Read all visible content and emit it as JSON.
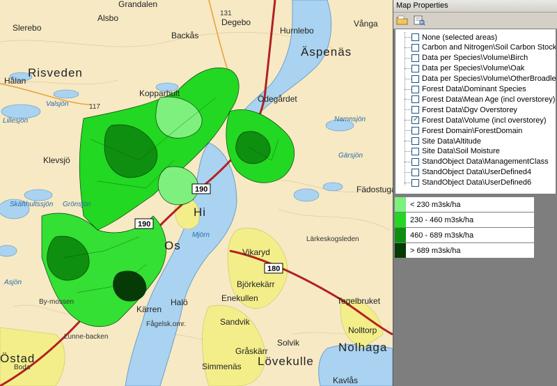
{
  "map": {
    "labels": {
      "risveden": "Risveden",
      "grandalen": "Grandalen",
      "alsbo": "Alsbo",
      "slerebo": "Slerebo",
      "backas": "Backås",
      "degebo": "Degebo",
      "hurnlebo": "Hurnlebo",
      "vanga": "Vånga",
      "aspenas": "Äspenäs",
      "halan": "Hålan",
      "odegardet": "Ödegårdet",
      "kopparhult": "Kopparhult",
      "valsjon": "Valsjön",
      "namnsjon": "Namnsjön",
      "garsjon": "Gärsjön",
      "fadostugan": "Fädostugan",
      "klevsjo": "Klevsjö",
      "skafthultssjon": "Skäfthultssjön",
      "mjorn": "Mjörn",
      "vikaryd": "Vikaryd",
      "larkeskogsleden": "Lärkeskogsleden",
      "bjorkekarr": "Björkekärr",
      "enekullen": "Enekullen",
      "sandvik": "Sandvik",
      "graskarr": "Gråskärr",
      "solvik": "Solvik",
      "tegelbruket": "Tegelbruket",
      "nolltorp": "Nolltorp",
      "nolhaga": "Nolhaga",
      "ostad": "Östad",
      "lunnebacken": "Lunne-backen",
      "boda": "Boda",
      "halo": "Halö",
      "fagelsk": "Fågelsk.omr.",
      "simmenas": "Simmenäs",
      "lovekulle": "Lövekulle",
      "kavlas": "Kavlås",
      "bymossen": "By-mossen",
      "asjon": "Asjön",
      "os": "Os",
      "hi": "Hi",
      "karren": "Kärren",
      "gronsjon": "Grönsjön",
      "lillesjon": "Lillesjön"
    },
    "roads": {
      "r190a": "190",
      "r190b": "190",
      "r180": "180",
      "r131": "131",
      "r117": "117"
    },
    "colors": {
      "land": "#f6e9c4",
      "water": "#a9d3f0",
      "forest_green": "#33e033",
      "urban": "#f3ee8a",
      "road": "#b32020"
    }
  },
  "panel": {
    "title": "Map Properties",
    "toolbar": [
      "open-folder-icon",
      "properties-icon"
    ],
    "layers": [
      {
        "label": "None (selected areas)",
        "checked": false
      },
      {
        "label": "Carbon and Nitrogen\\Soil Carbon Stock",
        "checked": false
      },
      {
        "label": "Data per Species\\Volume\\Birch",
        "checked": false
      },
      {
        "label": "Data per Species\\Volume\\Oak",
        "checked": false
      },
      {
        "label": "Data per Species\\Volume\\OtherBroadleaf",
        "checked": false
      },
      {
        "label": "Forest Data\\Dominant Species",
        "checked": false
      },
      {
        "label": "Forest Data\\Mean Age (incl overstorey)",
        "checked": false
      },
      {
        "label": "Forest Data\\Dgv Overstorey",
        "checked": false
      },
      {
        "label": "Forest Data\\Volume (incl overstorey)",
        "checked": true
      },
      {
        "label": "Forest Domain\\ForestDomain",
        "checked": false
      },
      {
        "label": "Site Data\\Altitude",
        "checked": false
      },
      {
        "label": "Site Data\\Soil Moisture",
        "checked": false
      },
      {
        "label": "StandObject Data\\ManagementClass",
        "checked": false
      },
      {
        "label": "StandObject Data\\UserDefined4",
        "checked": false
      },
      {
        "label": "StandObject Data\\UserDefined6",
        "checked": false
      }
    ],
    "legend": [
      {
        "label": "< 230 m3sk/ha",
        "color": "#7df07d"
      },
      {
        "label": "230 - 460 m3sk/ha",
        "color": "#22d822"
      },
      {
        "label": "460 - 689 m3sk/ha",
        "color": "#0f8f0f"
      },
      {
        "label": "> 689 m3sk/ha",
        "color": "#063a06"
      }
    ]
  }
}
